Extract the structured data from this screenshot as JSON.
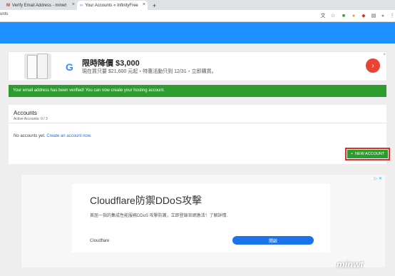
{
  "tabs": [
    {
      "label": ""
    },
    {
      "label": "Verify Email Address - minwt"
    },
    {
      "label": "Your Accounts « InfinityFree"
    }
  ],
  "new_tab_symbol": "+",
  "url": "unts",
  "alert": "Your email address has been verified! You can now create your hosting account.",
  "ad_top": {
    "title": "限時降價 $3,000",
    "subtitle": "現在買只要 $21,600 元起・特惠活動只到 12/31・立即購買。"
  },
  "accounts": {
    "title": "Accounts",
    "subtitle": "Active Accounts: 0 / 3",
    "empty_text": "No accounts yet.",
    "create_link": "Create an account now.",
    "new_button": "NEW ACCOUNT",
    "new_button_icon": "+"
  },
  "ad_cf": {
    "title": "Cloudflare防禦DDoS攻擊",
    "desc": "首屈一指的集成性能服務DDoS 攻擊防護，立即登錄官網激活！了解詳情.",
    "advertiser": "Cloudflare",
    "button": "開啟"
  },
  "watermark": "minwt",
  "colors": {
    "brand": "#1e90ff",
    "success": "#2e9b2e",
    "highlight": "#d9302a"
  }
}
